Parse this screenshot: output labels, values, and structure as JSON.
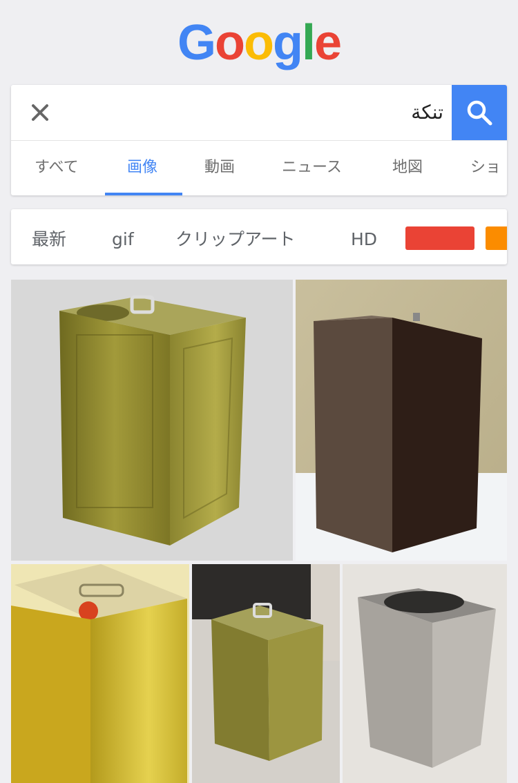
{
  "logo": {
    "letters": [
      "G",
      "o",
      "o",
      "g",
      "l",
      "e"
    ]
  },
  "search": {
    "query": "تنكة"
  },
  "tabs": [
    "すべて",
    "画像",
    "動画",
    "ニュース",
    "地図",
    "ショ"
  ],
  "active_tab": "画像",
  "filters": {
    "chips": [
      "最新",
      "gif",
      "クリップアート",
      "HD"
    ],
    "colors": [
      "#ea4335",
      "#fb8c00"
    ]
  },
  "results": [
    {
      "name": "gold-tin-can-image"
    },
    {
      "name": "rusty-tin-can-image"
    },
    {
      "name": "yellow-tin-can-image"
    },
    {
      "name": "green-tin-can-on-tiles-image"
    },
    {
      "name": "silver-tin-can-image"
    }
  ]
}
